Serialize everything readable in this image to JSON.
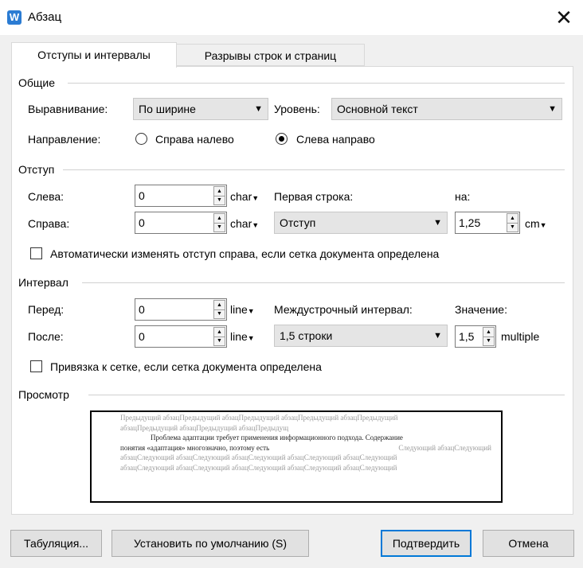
{
  "window": {
    "title": "Абзац",
    "app_icon": "W"
  },
  "tabs": [
    {
      "label": "Отступы и интервалы",
      "active": true
    },
    {
      "label": "Разрывы строк и страниц",
      "active": false
    }
  ],
  "general": {
    "title": "Общие",
    "alignment_label": "Выравнивание:",
    "alignment_value": "По ширине",
    "level_label": "Уровень:",
    "level_value": "Основной текст",
    "direction_label": "Направление:",
    "rtl_label": "Справа налево",
    "ltr_label": "Слева направо",
    "selected_direction": "ltr"
  },
  "indent": {
    "title": "Отступ",
    "left_label": "Слева:",
    "left_value": "0",
    "left_unit": "char",
    "right_label": "Справа:",
    "right_value": "0",
    "right_unit": "char",
    "first_line_label": "Первая строка:",
    "first_line_value": "Отступ",
    "by_label": "на:",
    "by_value": "1,25",
    "by_unit": "cm",
    "auto_adjust_label": "Автоматически изменять отступ справа, если сетка документа определена",
    "auto_adjust_checked": false
  },
  "spacing": {
    "title": "Интервал",
    "before_label": "Перед:",
    "before_value": "0",
    "before_unit": "line",
    "after_label": "После:",
    "after_value": "0",
    "after_unit": "line",
    "line_spacing_label": "Междустрочный интервал:",
    "line_spacing_value": "1,5 строки",
    "value_label": "Значение:",
    "value_value": "1,5",
    "value_unit": "multiple",
    "snap_label": "Привязка к сетке, если сетка документа определена",
    "snap_checked": false
  },
  "preview": {
    "title": "Просмотр",
    "prev_line1": "Предыдущий абзацПредыдущий абзацПредыдущий абзацПредыдущий абзацПредыдущий",
    "prev_line2": "абзацПредыдущий абзацПредыдущий абзацПредыдущ",
    "current_line1": "Проблема адаптации требует применения информационного подхода. Содержание",
    "current_line2a": "понятия «адаптация» многозначно, поэтому есть",
    "current_line2b": "Следующий абзацСледующий",
    "next_line1": "абзацСледующий абзацСледующий абзацСледующий абзацСледующий абзацСледующий",
    "next_line2": "абзацСледующий абзацСледующий абзацСледующий абзацСледующий абзацСледующий"
  },
  "buttons": {
    "tabs": "Табуляция...",
    "set_default": "Установить по умолчанию (S)",
    "confirm": "Подтвердить",
    "cancel": "Отмена"
  },
  "colors": {
    "accent": "#0078d7",
    "app_icon": "#2b7cd3"
  },
  "icons": {
    "close": "close-icon",
    "dropdown": "chevron-down-icon",
    "spinner": "spinner-arrows-icon"
  }
}
